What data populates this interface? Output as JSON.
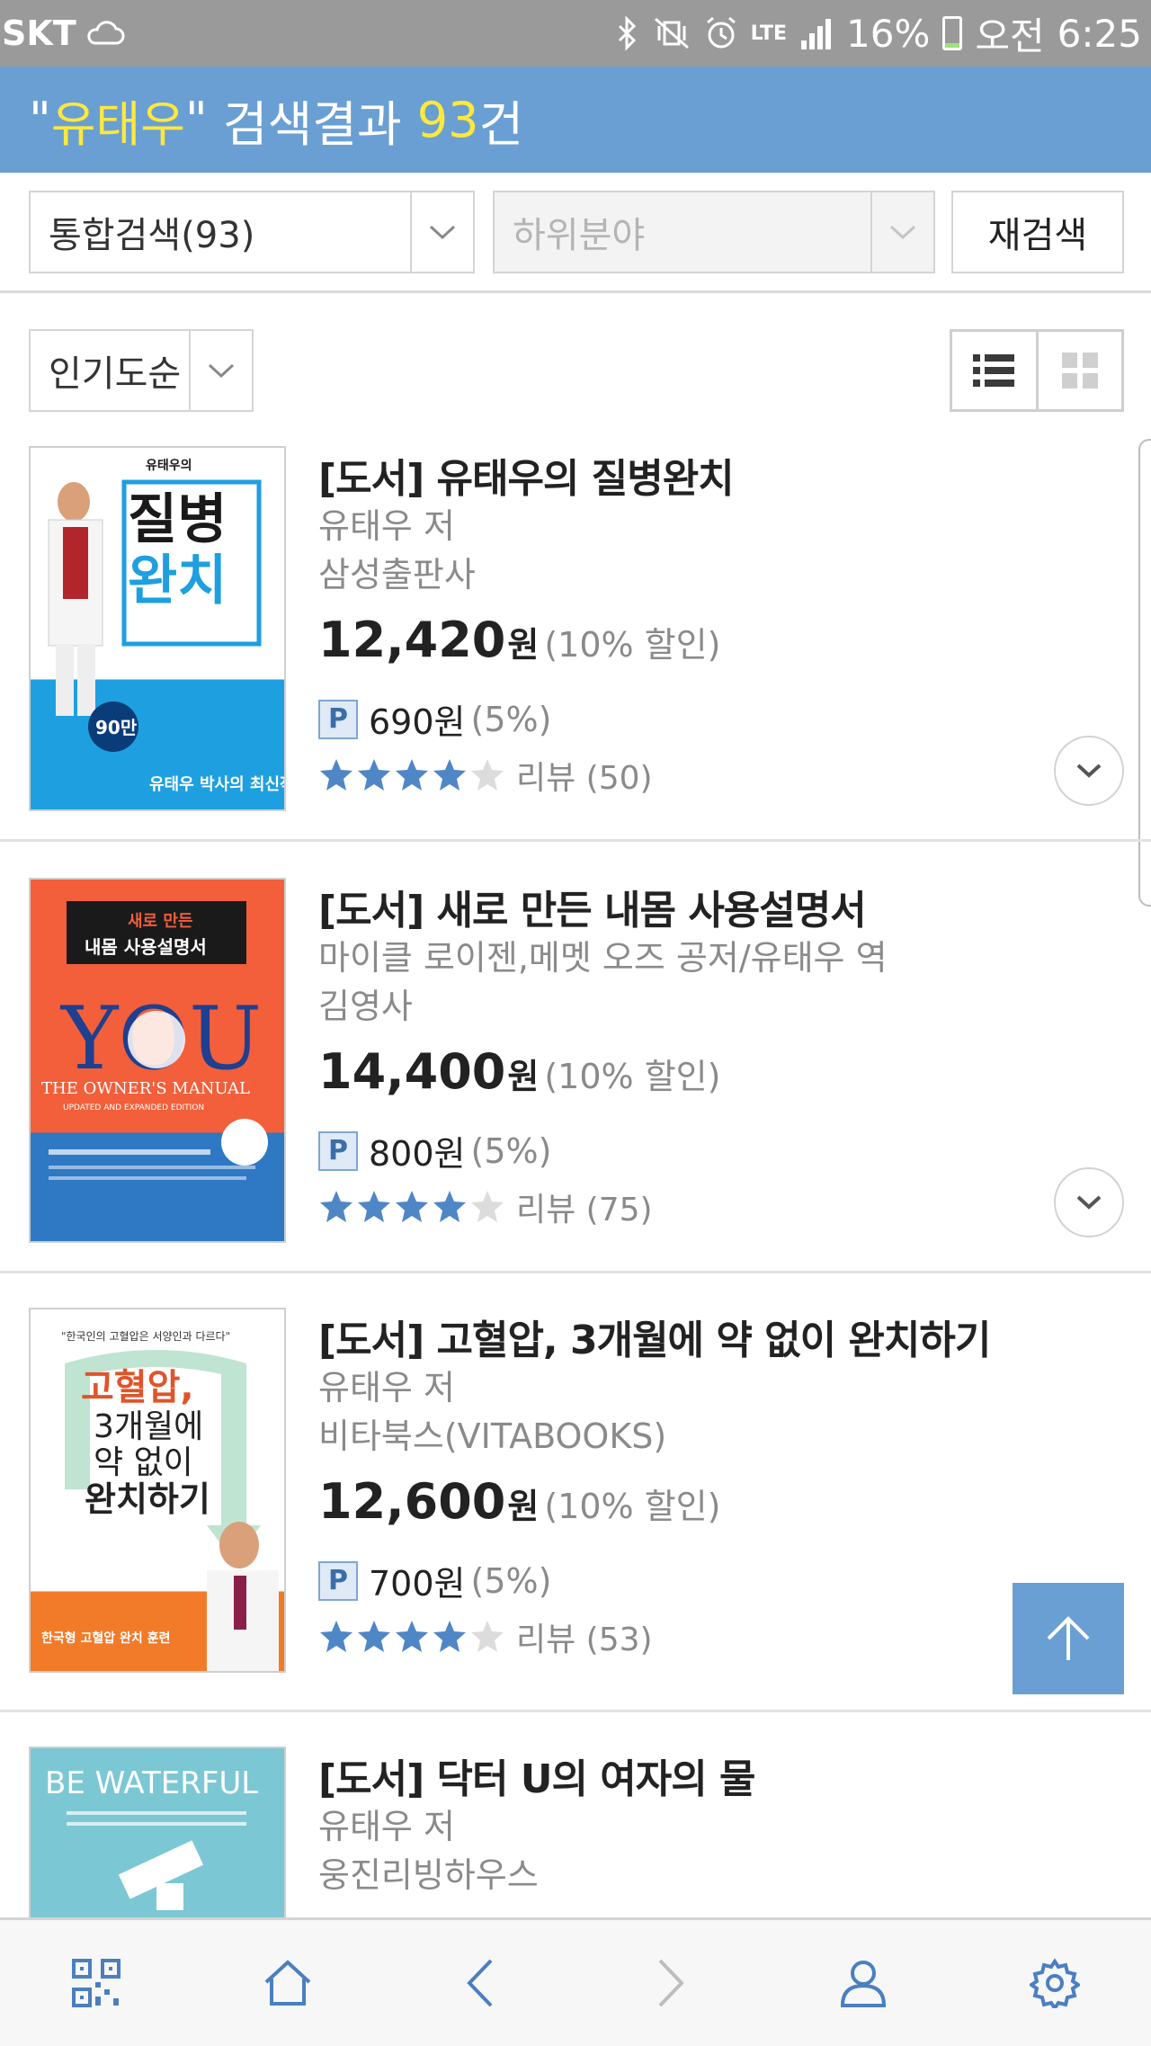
{
  "status_bar": {
    "carrier": "SKT",
    "network": "LTE",
    "battery": "16%",
    "battery_level": 0.16,
    "ampm": "오전",
    "time": "6:25"
  },
  "header": {
    "q_open": "\"",
    "keyword": "유태우",
    "q_close": "\"",
    "middle": " 검색결과 ",
    "count": "93",
    "suffix": "건"
  },
  "filters": {
    "category": "통합검색(93)",
    "subcategory_placeholder": "하위분야",
    "research_label": "재검색",
    "sort": "인기도순"
  },
  "colors": {
    "header_bg": "#6a9fd3",
    "highlight": "#ffe83c",
    "star_filled": "#4f86c6",
    "star_empty": "#dcdcdc"
  },
  "items": [
    {
      "title": "[도서] 유태우의 질병완치",
      "author": "유태우 저",
      "publisher": "삼성출판사",
      "price": "12,420",
      "won": "원",
      "discount": "(10% 할인)",
      "points": "690원",
      "points_rate": "(5%)",
      "rating": 4,
      "review": "리뷰 (50)",
      "cover": {
        "small": "유태우의",
        "line1": "질병",
        "line2": "완치",
        "badge": "90만",
        "tagline": "유태우 박사의 최신작!"
      }
    },
    {
      "title": "[도서] 새로 만든 내몸 사용설명서",
      "author": "마이클 로이젠,메멧 오즈 공저/유태우 역",
      "publisher": "김영사",
      "price": "14,400",
      "won": "원",
      "discount": "(10% 할인)",
      "points": "800원",
      "points_rate": "(5%)",
      "rating": 4,
      "review": "리뷰 (75)",
      "cover": {
        "box1": "새로 만든",
        "box2": "내몸 사용설명서",
        "big": "YOU",
        "sub": "THE OWNER'S MANUAL",
        "sub2": "UPDATED AND EXPANDED EDITION"
      }
    },
    {
      "title": "[도서] 고혈압, 3개월에 약 없이 완치하기",
      "author": "유태우 저",
      "publisher": "비타북스(VITABOOKS)",
      "price": "12,600",
      "won": "원",
      "discount": "(10% 할인)",
      "points": "700원",
      "points_rate": "(5%)",
      "rating": 4,
      "review": "리뷰 (53)",
      "cover": {
        "quote": "\"한국인의 고혈압은 서양인과 다르다\"",
        "l1": "고혈압,",
        "l2": "3개월에",
        "l3": "약 없이",
        "l4": "완치하기",
        "bottom": "한국형 고혈압 완치 훈련"
      }
    },
    {
      "title": "[도서] 닥터 U의 여자의 물",
      "author": "유태우 저",
      "publisher": "웅진리빙하우스",
      "cover": {
        "big": "BE WATERFUL"
      }
    }
  ],
  "bottom_nav": [
    "qr-code-icon",
    "home-icon",
    "back-icon",
    "forward-icon",
    "user-icon",
    "settings-icon"
  ]
}
